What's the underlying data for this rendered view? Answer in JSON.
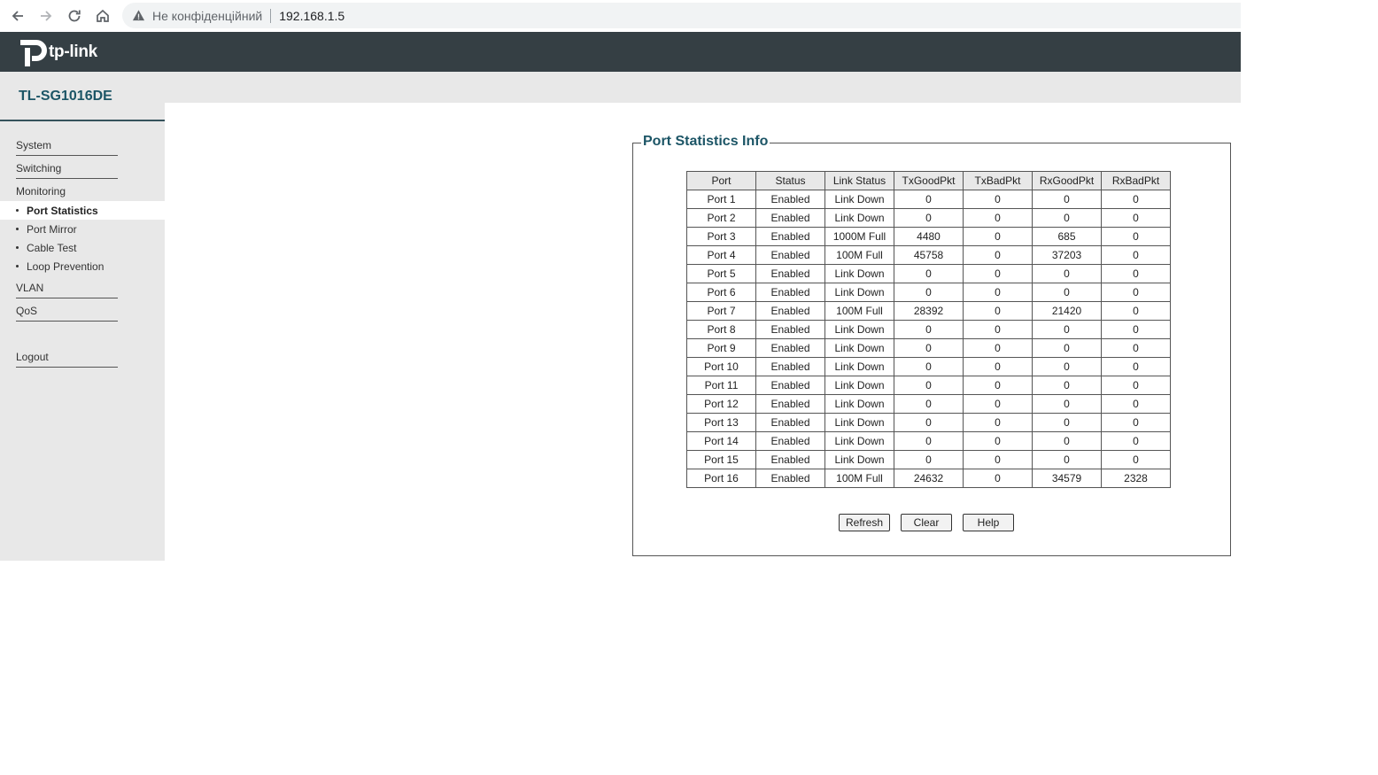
{
  "browser": {
    "not_secure_label": "Не конфіденційний",
    "url": "192.168.1.5"
  },
  "header": {
    "logo_text": "tp-link",
    "brand_color": "#353f44"
  },
  "sidebar": {
    "model": "TL-SG1016DE",
    "menu": {
      "system": "System",
      "switching": "Switching",
      "monitoring": "Monitoring",
      "vlan": "VLAN",
      "qos": "QoS",
      "logout": "Logout"
    },
    "monitoring_items": [
      {
        "label": "Port Statistics",
        "active": true
      },
      {
        "label": "Port Mirror",
        "active": false
      },
      {
        "label": "Cable Test",
        "active": false
      },
      {
        "label": "Loop Prevention",
        "active": false
      }
    ]
  },
  "main": {
    "title": "Port Statistics Info",
    "columns": [
      "Port",
      "Status",
      "Link Status",
      "TxGoodPkt",
      "TxBadPkt",
      "RxGoodPkt",
      "RxBadPkt"
    ],
    "rows": [
      [
        "Port 1",
        "Enabled",
        "Link Down",
        "0",
        "0",
        "0",
        "0"
      ],
      [
        "Port 2",
        "Enabled",
        "Link Down",
        "0",
        "0",
        "0",
        "0"
      ],
      [
        "Port 3",
        "Enabled",
        "1000M Full",
        "4480",
        "0",
        "685",
        "0"
      ],
      [
        "Port 4",
        "Enabled",
        "100M Full",
        "45758",
        "0",
        "37203",
        "0"
      ],
      [
        "Port 5",
        "Enabled",
        "Link Down",
        "0",
        "0",
        "0",
        "0"
      ],
      [
        "Port 6",
        "Enabled",
        "Link Down",
        "0",
        "0",
        "0",
        "0"
      ],
      [
        "Port 7",
        "Enabled",
        "100M Full",
        "28392",
        "0",
        "21420",
        "0"
      ],
      [
        "Port 8",
        "Enabled",
        "Link Down",
        "0",
        "0",
        "0",
        "0"
      ],
      [
        "Port 9",
        "Enabled",
        "Link Down",
        "0",
        "0",
        "0",
        "0"
      ],
      [
        "Port 10",
        "Enabled",
        "Link Down",
        "0",
        "0",
        "0",
        "0"
      ],
      [
        "Port 11",
        "Enabled",
        "Link Down",
        "0",
        "0",
        "0",
        "0"
      ],
      [
        "Port 12",
        "Enabled",
        "Link Down",
        "0",
        "0",
        "0",
        "0"
      ],
      [
        "Port 13",
        "Enabled",
        "Link Down",
        "0",
        "0",
        "0",
        "0"
      ],
      [
        "Port 14",
        "Enabled",
        "Link Down",
        "0",
        "0",
        "0",
        "0"
      ],
      [
        "Port 15",
        "Enabled",
        "Link Down",
        "0",
        "0",
        "0",
        "0"
      ],
      [
        "Port 16",
        "Enabled",
        "100M Full",
        "24632",
        "0",
        "34579",
        "2328"
      ]
    ],
    "buttons": {
      "refresh": "Refresh",
      "clear": "Clear",
      "help": "Help"
    }
  },
  "icons": [
    "back-icon",
    "forward-icon",
    "reload-icon",
    "home-icon",
    "warning-icon",
    "tp-link-logo-icon"
  ]
}
